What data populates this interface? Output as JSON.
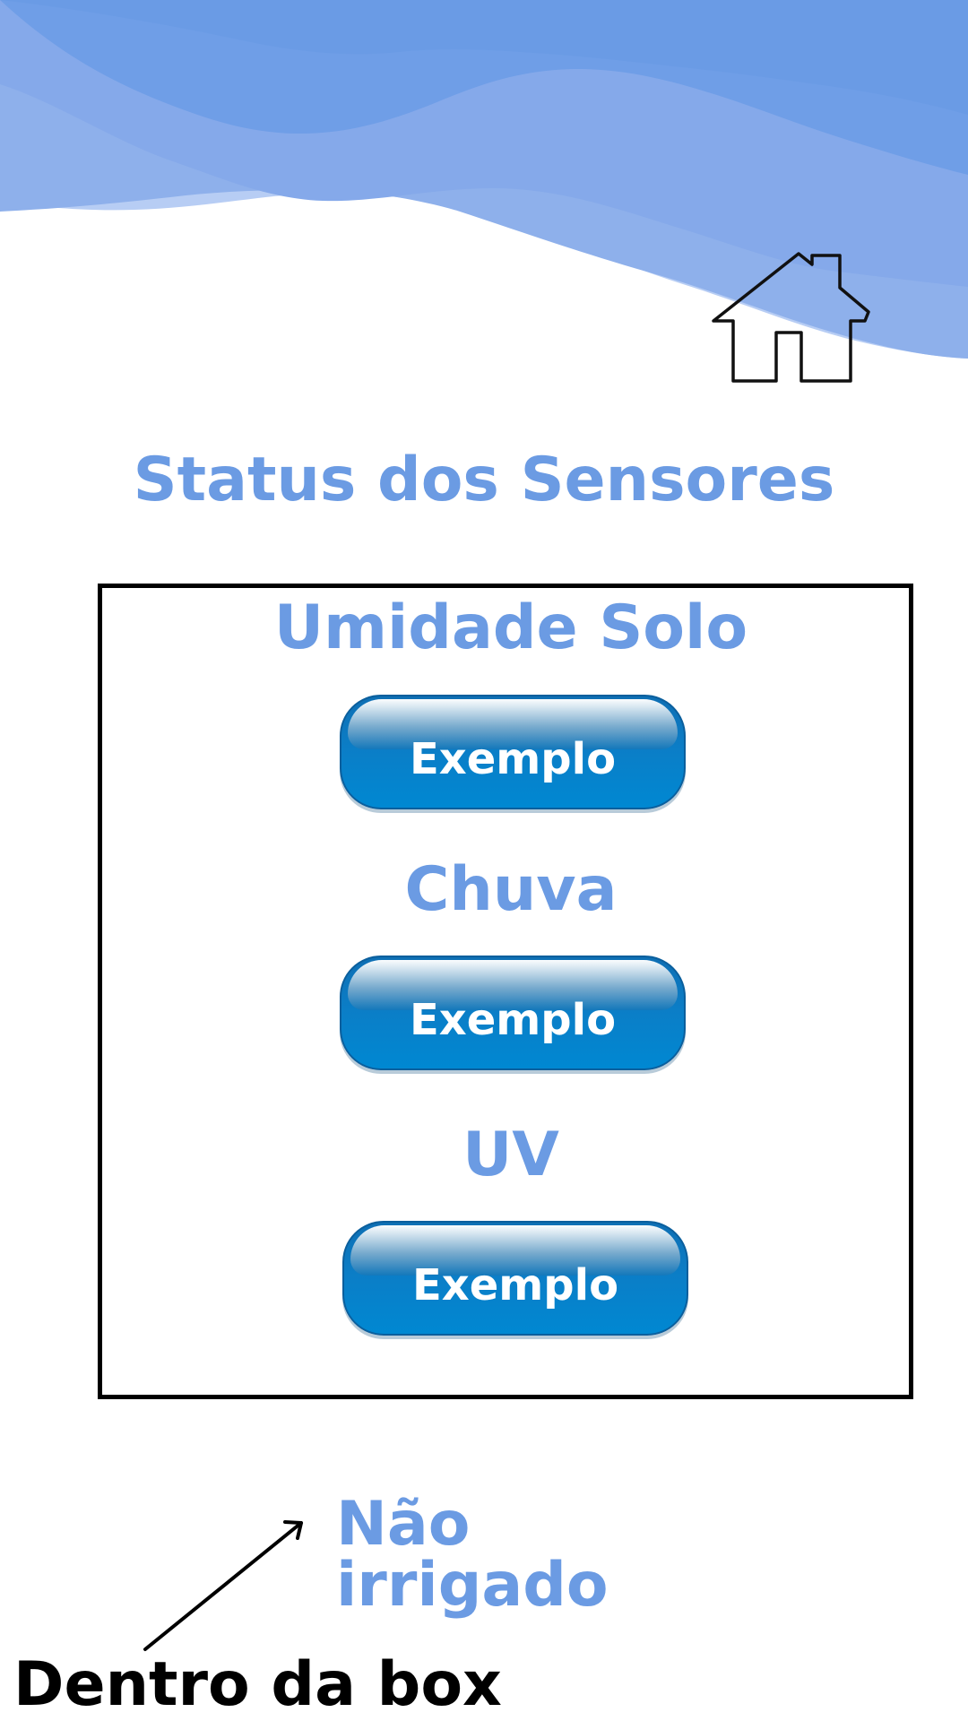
{
  "header": {
    "home_icon": "home-icon"
  },
  "page_title": "Status dos Sensores",
  "sensors": [
    {
      "label": "Umidade Solo",
      "button_label": "Exemplo"
    },
    {
      "label": "Chuva",
      "button_label": "Exemplo"
    },
    {
      "label": "UV",
      "button_label": "Exemplo"
    }
  ],
  "irrigation_status": "Não irrigado",
  "annotation": {
    "note": "Dentro da box"
  },
  "colors": {
    "accent_blue": "#6b9be3",
    "button_blue": "#0088d2",
    "wave_light": "#b7cdf4",
    "border": "#000000"
  }
}
